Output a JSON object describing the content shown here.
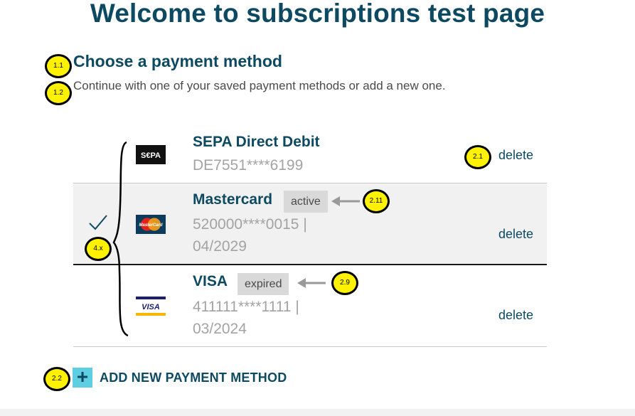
{
  "page": {
    "title": "Welcome to subscriptions test page"
  },
  "section": {
    "heading": "Choose a payment method",
    "description": "Continue with one of your saved payment methods or add a new one."
  },
  "payment_methods": [
    {
      "name": "SEPA Direct Debit",
      "logo": "SEPA",
      "logo_icon": "sepa-logo-icon",
      "number_line1": "DE7551****6199",
      "number_line2": "",
      "badge": "",
      "delete_label": "delete",
      "selected": false
    },
    {
      "name": "Mastercard",
      "logo": "MasterCard",
      "logo_icon": "mastercard-logo-icon",
      "number_line1": "520000****0015 |",
      "number_line2": "04/2029",
      "badge": "active",
      "delete_label": "delete",
      "selected": true
    },
    {
      "name": "VISA",
      "logo": "VISA",
      "logo_icon": "visa-logo-icon",
      "number_line1": "411111****1111 |",
      "number_line2": "03/2024",
      "badge": "expired",
      "delete_label": "delete",
      "selected": false
    }
  ],
  "add_method": {
    "icon": "plus-icon",
    "label": "ADD NEW PAYMENT METHOD"
  },
  "annotations": {
    "heading": "1.1",
    "description": "1.2",
    "delete": "2.1",
    "add": "2.2",
    "expired": "2.9",
    "active": "2.11",
    "selection": "4.x"
  },
  "colors": {
    "primary": "#0d4a62",
    "accent": "#5ecfe3",
    "annotation": "#fff200",
    "selected_row": "#f1f1f1",
    "muted_text": "#a3a3a3"
  }
}
